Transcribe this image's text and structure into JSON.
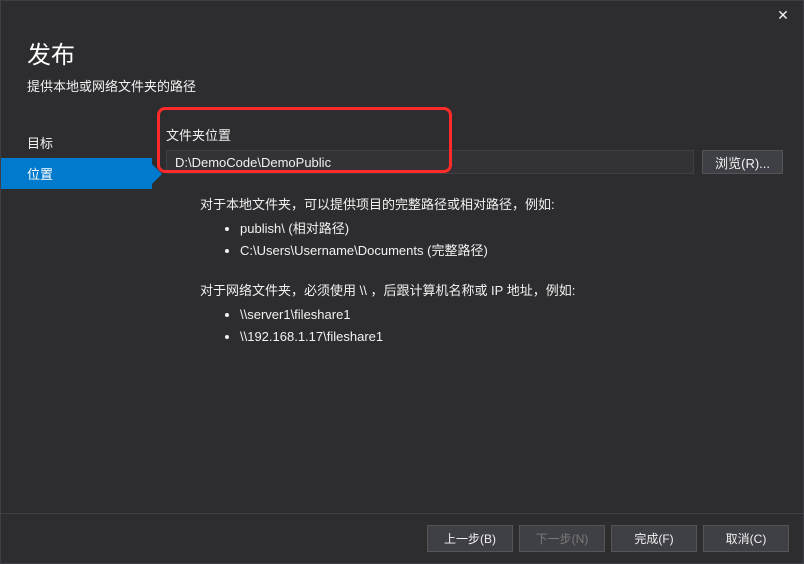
{
  "header": {
    "title": "发布",
    "subtitle": "提供本地或网络文件夹的路径"
  },
  "sidebar": {
    "items": [
      {
        "label": "目标",
        "active": false
      },
      {
        "label": "位置",
        "active": true
      }
    ]
  },
  "main": {
    "folder_label": "文件夹位置",
    "folder_value": "D:\\DemoCode\\DemoPublic",
    "browse_label": "浏览(R)...",
    "help_local_intro": "对于本地文件夹，可以提供项目的完整路径或相对路径，例如:",
    "help_local_items": [
      "publish\\ (相对路径)",
      "C:\\Users\\Username\\Documents (完整路径)"
    ],
    "help_net_intro": "对于网络文件夹，必须使用 \\\\ ，后跟计算机名称或 IP 地址，例如:",
    "help_net_items": [
      "\\\\server1\\fileshare1",
      "\\\\192.168.1.17\\fileshare1"
    ]
  },
  "footer": {
    "back": "上一步(B)",
    "next": "下一步(N)",
    "finish": "完成(F)",
    "cancel": "取消(C)"
  }
}
